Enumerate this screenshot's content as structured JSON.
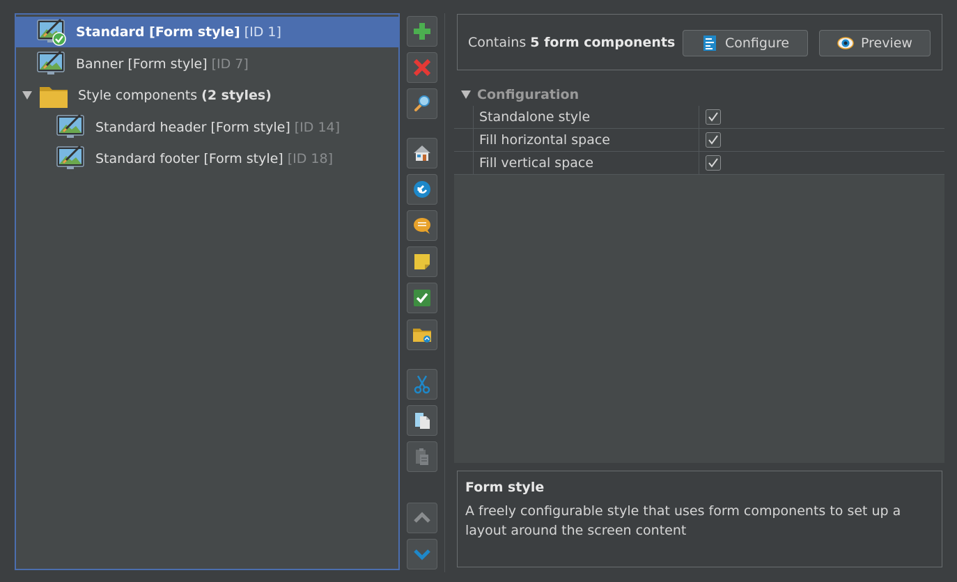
{
  "tree": {
    "items": [
      {
        "name": "Standard",
        "type": "[Form style]",
        "id": "[ID 1]",
        "selected": true
      },
      {
        "name": "Banner",
        "type": "[Form style]",
        "id": "[ID 7]"
      },
      {
        "folder": "Style components",
        "count": "(2 styles)"
      },
      {
        "name": "Standard header",
        "type": "[Form style]",
        "id": "[ID 14]"
      },
      {
        "name": "Standard footer",
        "type": "[Form style]",
        "id": "[ID 18]"
      }
    ]
  },
  "toolbar": {
    "buttons": [
      {
        "icon": "plus-icon",
        "color": "#4caf50"
      },
      {
        "icon": "delete-icon",
        "color": "#e53935"
      },
      {
        "icon": "search-icon"
      },
      {
        "icon": "home-icon"
      },
      {
        "icon": "back-arrow-icon"
      },
      {
        "icon": "comment-icon"
      },
      {
        "icon": "note-icon"
      },
      {
        "icon": "checkmark-icon"
      },
      {
        "icon": "folder-link-icon"
      },
      {
        "icon": "cut-icon"
      },
      {
        "icon": "copy-icon"
      },
      {
        "icon": "paste-icon"
      },
      {
        "icon": "move-up-icon"
      },
      {
        "icon": "move-down-icon"
      }
    ]
  },
  "info": {
    "contains_prefix": "Contains",
    "contains_count": "5 form components",
    "configure_label": "Configure",
    "preview_label": "Preview"
  },
  "config": {
    "header": "Configuration",
    "properties": [
      {
        "name": "Standalone style",
        "checked": true
      },
      {
        "name": "Fill horizontal space",
        "checked": true
      },
      {
        "name": "Fill vertical space",
        "checked": true
      }
    ]
  },
  "description": {
    "title": "Form style",
    "text": "A freely configurable style that uses form components to set up a layout around the screen content"
  },
  "colors": {
    "selection": "#4b6eaf",
    "panel": "#45494a",
    "background": "#3c3f41"
  }
}
